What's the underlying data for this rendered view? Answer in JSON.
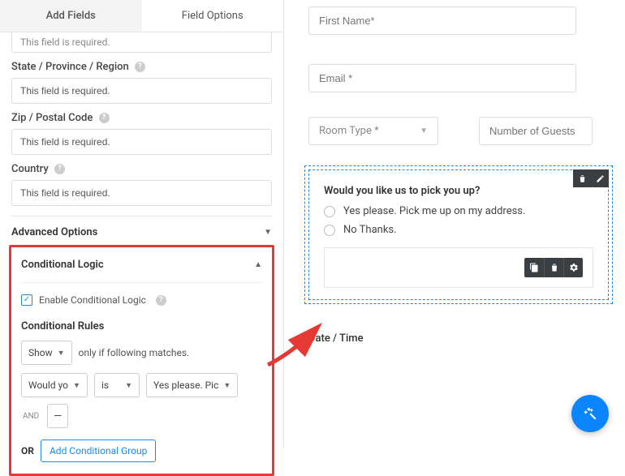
{
  "tabs": {
    "add_fields": "Add Fields",
    "field_options": "Field Options"
  },
  "left": {
    "truncated": "This field is required.",
    "state_label": "State / Province / Region",
    "state_value": "This field is required.",
    "zip_label": "Zip / Postal Code",
    "zip_value": "This field is required.",
    "country_label": "Country",
    "country_value": "This field is required.",
    "advanced": "Advanced Options",
    "cond_logic": "Conditional Logic",
    "enable_label": "Enable Conditional Logic",
    "rules_label": "Conditional Rules",
    "show_option": "Show",
    "only_if": "only if following matches.",
    "field_sel": "Would yo",
    "op_sel": "is",
    "val_sel": "Yes please. Pic",
    "and": "AND",
    "or": "OR",
    "add_group": "Add Conditional Group"
  },
  "right": {
    "first_name": "First Name*",
    "email": "Email *",
    "room_type": "Room Type *",
    "guests": "Number of Guests",
    "question": "Would you like us to pick you up?",
    "opt1": "Yes please. Pick me up on my address.",
    "opt2": "No Thanks.",
    "date": "Date / Time"
  }
}
